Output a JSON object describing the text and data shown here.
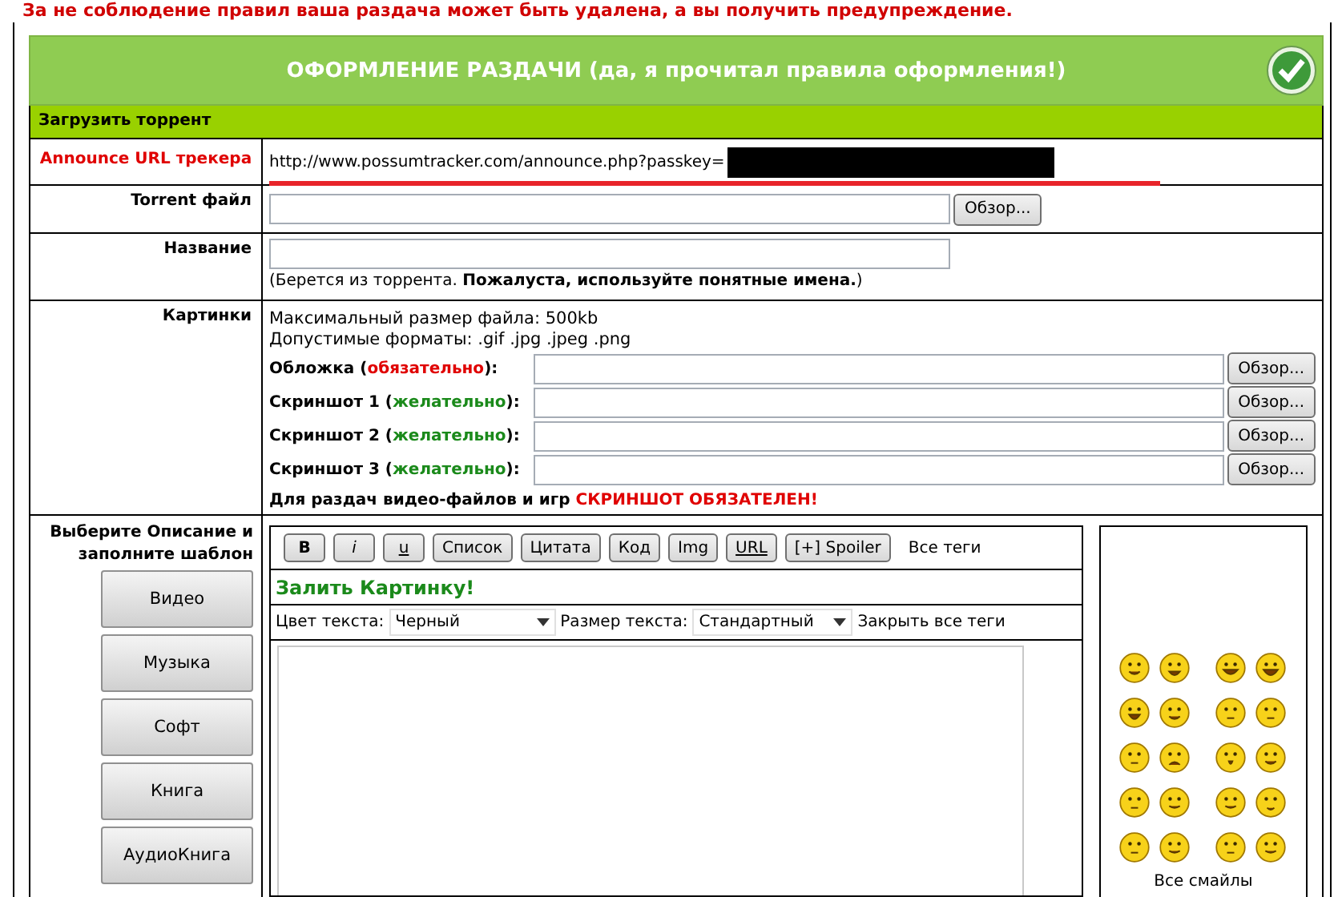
{
  "warning": "За не соблюдение правил ваша раздача может быть удалена, а вы получить предупреждение.",
  "header": {
    "title": "ОФОРМЛЕНИЕ РАЗДАЧИ (да, я прочитал правила оформления!)"
  },
  "section_title": "Загрузить торрент",
  "announce": {
    "label": "Announce URL трекера",
    "url": "http://www.possumtracker.com/announce.php?passkey="
  },
  "torrent_file": {
    "label": "Torrent файл",
    "button": "Обзор..."
  },
  "name": {
    "label": "Название",
    "hint": "(Берется из торрента. **Пожалуста, используйте понятные имена.**)"
  },
  "pictures": {
    "label": "Картинки",
    "info": [
      "Максимальный размер файла: 500kb",
      "Допустимые форматы: .gif .jpg .jpeg .png"
    ],
    "fields": [
      {
        "prefix": "Обложка (",
        "note": "обязательно",
        "suffix": "):",
        "kind": "required",
        "button": "Обзор..."
      },
      {
        "prefix": "Скриншот 1 (",
        "note": "желательно",
        "suffix": "):",
        "kind": "optional",
        "button": "Обзор..."
      },
      {
        "prefix": "Скриншот 2 (",
        "note": "желательно",
        "suffix": "):",
        "kind": "optional",
        "button": "Обзор..."
      },
      {
        "prefix": "Скриншот 3 (",
        "note": "желательно",
        "suffix": "):",
        "kind": "optional",
        "button": "Обзор..."
      }
    ],
    "notice": "Для раздач видео-файлов и игр",
    "notice_emphasis": "СКРИНШОТ ОБЯЗАТЕЛЕН!"
  },
  "description": {
    "label": "Выберите Описание и заполните шаблон",
    "categories": [
      "Видео",
      "Музыка",
      "Софт",
      "Книга",
      "АудиоКнига"
    ],
    "toolbar": [
      {
        "label": "B",
        "kind": "bold"
      },
      {
        "label": "i",
        "kind": "italic"
      },
      {
        "label": "u",
        "kind": "underline"
      },
      {
        "label": "Список",
        "kind": "plain"
      },
      {
        "label": "Цитата",
        "kind": "plain"
      },
      {
        "label": "Код",
        "kind": "plain"
      },
      {
        "label": "Img",
        "kind": "plain"
      },
      {
        "label": "URL",
        "kind": "underline"
      },
      {
        "label": "[+] Spoiler",
        "kind": "plain"
      }
    ],
    "all_tags": "Все теги",
    "upload_image": "Залить Картинку!",
    "color_label": "Цвет текста:",
    "color_value": "Черный",
    "size_label": "Размер текста:",
    "size_value": "Стандартный",
    "close_tags": "Закрыть все теги",
    "all_smileys": "Все смайлы"
  }
}
